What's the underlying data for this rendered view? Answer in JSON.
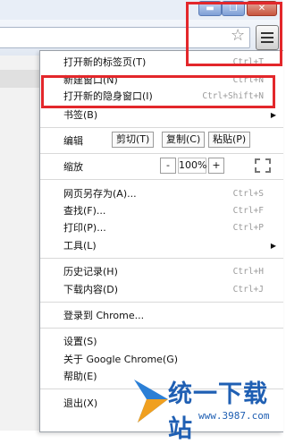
{
  "window": {
    "minimize_glyph": "▬",
    "maximize_glyph": "❐",
    "close_glyph": "✕"
  },
  "toolbar": {
    "bookmark_icon": "star-icon",
    "star_glyph": "☆",
    "menu_icon": "hamburger-menu-icon"
  },
  "menu": {
    "new_tab": {
      "label": "打开新的标签页(T)",
      "shortcut": "Ctrl+T"
    },
    "new_window": {
      "label": "新建窗口(N)",
      "shortcut": "Ctrl+N"
    },
    "incognito": {
      "label": "打开新的隐身窗口(I)",
      "shortcut": "Ctrl+Shift+N"
    },
    "bookmarks": {
      "label": "书签(B)",
      "arrow": "▶"
    },
    "edit": {
      "label": "编辑",
      "cut": "剪切(T)",
      "copy": "复制(C)",
      "paste": "粘贴(P)"
    },
    "zoom": {
      "label": "缩放",
      "minus": "-",
      "value": "100%",
      "plus": "+"
    },
    "save_as": {
      "label": "网页另存为(A)...",
      "shortcut": "Ctrl+S"
    },
    "find": {
      "label": "查找(F)...",
      "shortcut": "Ctrl+F"
    },
    "print": {
      "label": "打印(P)...",
      "shortcut": "Ctrl+P"
    },
    "tools": {
      "label": "工具(L)",
      "arrow": "▶"
    },
    "history": {
      "label": "历史记录(H)",
      "shortcut": "Ctrl+H"
    },
    "downloads": {
      "label": "下载内容(D)",
      "shortcut": "Ctrl+J"
    },
    "sign_in": {
      "label": "登录到 Chrome..."
    },
    "settings": {
      "label": "设置(S)"
    },
    "about": {
      "label": "关于 Google Chrome(G)"
    },
    "help": {
      "label": "帮助(E)"
    },
    "exit": {
      "label": "退出(X)"
    }
  },
  "watermark": {
    "text": "统一下载站",
    "url": "www.3987.com"
  },
  "colors": {
    "highlight": "#e3272b",
    "watermark": "#1f5fb3"
  }
}
